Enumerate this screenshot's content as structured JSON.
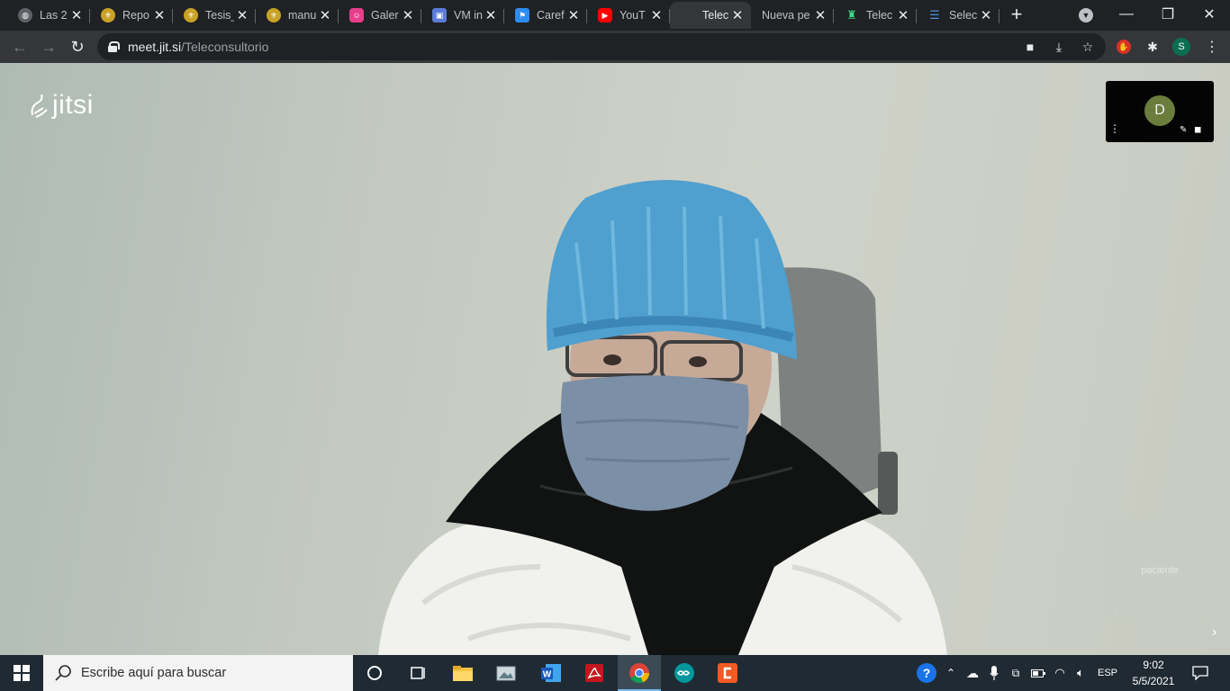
{
  "browser": {
    "tabs": [
      {
        "title": "Las 2",
        "icon": "globe-icon",
        "color": "#5f6368",
        "active": false
      },
      {
        "title": "Repo",
        "icon": "university-seal-icon",
        "color": "#c9a227",
        "active": false
      },
      {
        "title": "Tesis_",
        "icon": "university-seal-icon",
        "color": "#c9a227",
        "active": false
      },
      {
        "title": "manu",
        "icon": "university-seal-icon",
        "color": "#c9a227",
        "active": false
      },
      {
        "title": "Galer",
        "icon": "gallery-icon",
        "color": "#e83e8c",
        "active": false
      },
      {
        "title": "VM in",
        "icon": "chip-icon",
        "color": "#5b7bd6",
        "active": false
      },
      {
        "title": "Caref",
        "icon": "flag-icon",
        "color": "#2d8cf0",
        "active": false
      },
      {
        "title": "YouT",
        "icon": "youtube-icon",
        "color": "#ff0000",
        "active": false
      },
      {
        "title": "Telec",
        "icon": "jitsi-icon",
        "color": "#35363a",
        "active": true
      },
      {
        "title": "Nueva pe",
        "icon": "",
        "color": "",
        "active": false
      },
      {
        "title": "Telec",
        "icon": "android-icon",
        "color": "#3ddc84",
        "active": false
      },
      {
        "title": "Selec",
        "icon": "list-icon",
        "color": "#4a90d9",
        "active": false
      }
    ],
    "close_glyph": "✕",
    "new_tab_glyph": "+",
    "url": {
      "host": "meet.jit.si",
      "path": "/Teleconsultorio"
    },
    "profile_initial": "S"
  },
  "meeting": {
    "logo_text": "jitsi",
    "participant_initial": "D",
    "participant_avatar_color": "#6b7d3c",
    "ghost_name": "paciente"
  },
  "taskbar": {
    "search_placeholder": "Escribe aquí para buscar",
    "language": "ESP",
    "time": "9:02",
    "date": "5/5/2021",
    "accent": "#76b9ed"
  }
}
